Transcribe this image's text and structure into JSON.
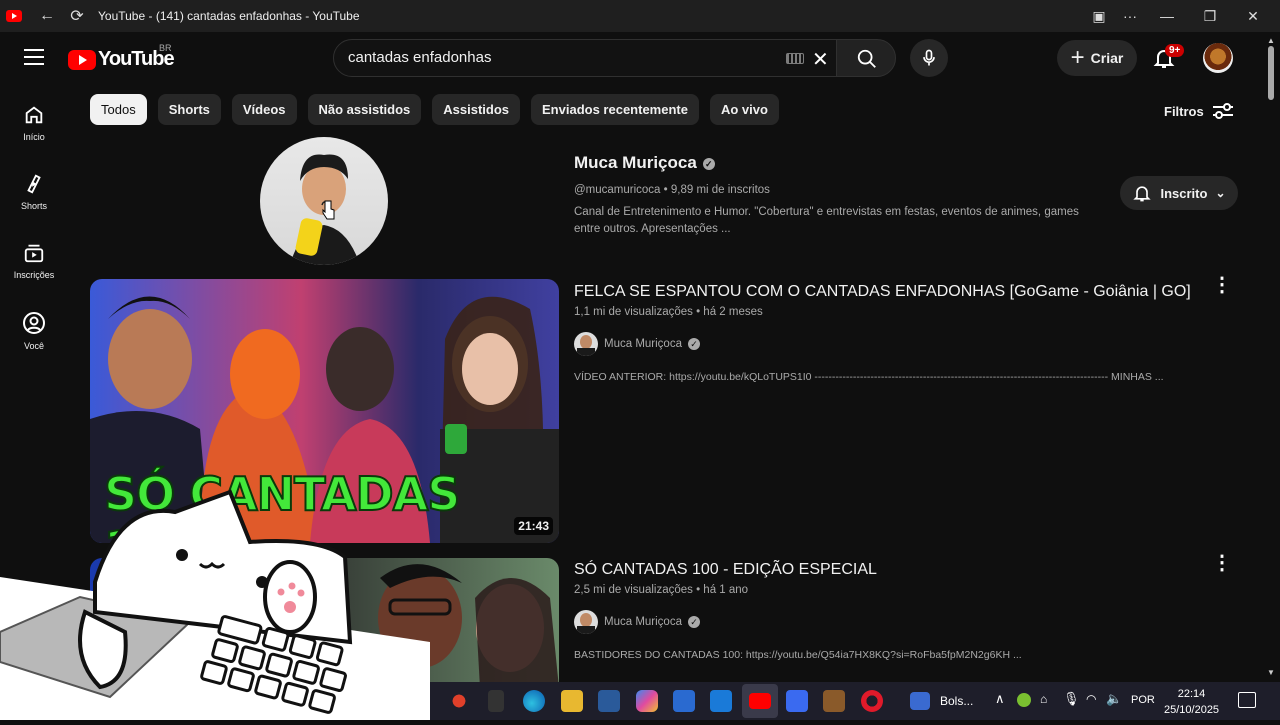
{
  "window": {
    "title": "YouTube - (141) cantadas enfadonhas - YouTube"
  },
  "header": {
    "logo_text": "YouTube",
    "country": "BR",
    "search_value": "cantadas enfadonhas",
    "create_label": "Criar",
    "notifications_badge": "9+"
  },
  "sidebar": {
    "items": [
      {
        "label": "Início",
        "icon": "home-icon"
      },
      {
        "label": "Shorts",
        "icon": "shorts-icon"
      },
      {
        "label": "Inscrições",
        "icon": "subscriptions-icon"
      },
      {
        "label": "Você",
        "icon": "you-icon"
      }
    ]
  },
  "chips": [
    "Todos",
    "Shorts",
    "Vídeos",
    "Não assistidos",
    "Assistidos",
    "Enviados recentemente",
    "Ao vivo"
  ],
  "filters_label": "Filtros",
  "channel": {
    "name": "Muca Muriçoca",
    "meta": "@mucamuricoca • 9,89 mi de inscritos",
    "description": "Canal de Entretenimento e Humor. \"Cobertura\" e entrevistas em festas, eventos de animes, games entre outros. Apresentações ...",
    "subscribe_label": "Inscrito"
  },
  "videos": [
    {
      "title": "FELCA SE ESPANTOU COM O CANTADAS ENFADONHAS [GoGame - Goiânia | GO]",
      "meta": "1,1 mi de visualizações • há 2 meses",
      "channel": "Muca Muriçoca",
      "description": "VÍDEO ANTERIOR: https://youtu.be/kQLoTUPS1I0 ------------------------------------------------------------------------------------ MINHAS ...",
      "duration": "21:43",
      "thumb_text": "SÓ CANTADAS 111"
    },
    {
      "title": "SÓ CANTADAS 100 - EDIÇÃO ESPECIAL",
      "meta": "2,5 mi de visualizações • há 1 ano",
      "channel": "Muca Muriçoca",
      "description": "BASTIDORES DO CANTADAS 100: https://youtu.be/Q54ia7HX8KQ?si=RoFba5fpM2N2g6KH ..."
    }
  ],
  "taskbar": {
    "bolsa_label": "Bols...",
    "language": "POR",
    "time": "22:14",
    "date": "25/10/2025"
  }
}
